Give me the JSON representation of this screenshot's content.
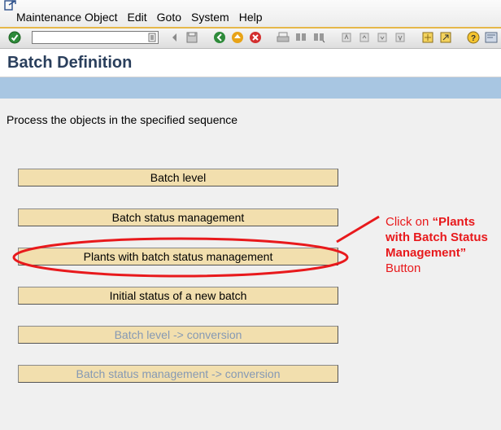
{
  "menubar": {
    "icon": "exit-arrow-icon",
    "items": [
      "Maintenance Object",
      "Edit",
      "Goto",
      "System",
      "Help"
    ]
  },
  "toolbar": {
    "command_value": "",
    "icons": [
      "enter-checkmark-icon",
      "command-dropdown-icon",
      "back-nav-icon",
      "save-icon",
      "back-icon",
      "exit-icon",
      "cancel-icon",
      "print-icon",
      "find-icon",
      "find-next-icon",
      "first-page-icon",
      "previous-page-icon",
      "next-page-icon",
      "last-page-icon",
      "create-session-icon",
      "shortcut-icon",
      "help-icon",
      "customize-layout-icon"
    ]
  },
  "title": "Batch Definition",
  "instruction": "Process the objects in the specified sequence",
  "buttons": [
    {
      "label": "Batch level",
      "enabled": true
    },
    {
      "label": "Batch status management",
      "enabled": true
    },
    {
      "label": "Plants with batch status management",
      "enabled": true
    },
    {
      "label": "Initial status of a new batch",
      "enabled": true
    },
    {
      "label": "Batch level -> conversion",
      "enabled": false
    },
    {
      "label": "Batch status management -> conversion",
      "enabled": false
    }
  ],
  "callout": {
    "prefix": "Click on ",
    "bold": "“Plants with Batch Status Management”",
    "suffix": "Button",
    "color": "#e8191c"
  },
  "colors": {
    "accent_line": "#e6b84a",
    "app_bar": "#a8c6e2",
    "button_bg": "#f2dfae",
    "title_text": "#2a3f5c",
    "disabled_text": "#8599b4"
  }
}
